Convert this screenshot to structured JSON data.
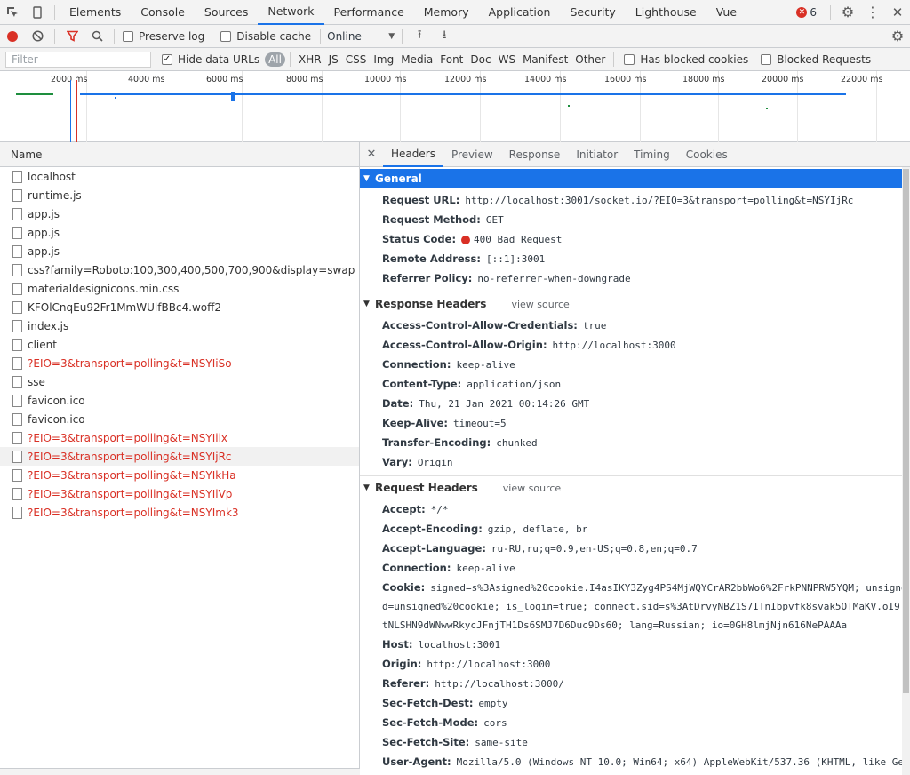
{
  "tabs": [
    "Elements",
    "Console",
    "Sources",
    "Network",
    "Performance",
    "Memory",
    "Application",
    "Security",
    "Lighthouse",
    "Vue"
  ],
  "active_tab": "Network",
  "error_count": "6",
  "toolbar": {
    "preserve_log": "Preserve log",
    "disable_cache": "Disable cache",
    "throttle": "Online"
  },
  "filter": {
    "placeholder": "Filter",
    "hide_data_urls": "Hide data URLs",
    "types": [
      "All",
      "XHR",
      "JS",
      "CSS",
      "Img",
      "Media",
      "Font",
      "Doc",
      "WS",
      "Manifest",
      "Other"
    ],
    "has_blocked_cookies": "Has blocked cookies",
    "blocked_requests": "Blocked Requests"
  },
  "overview": {
    "ticks": [
      "2000 ms",
      "4000 ms",
      "6000 ms",
      "8000 ms",
      "10000 ms",
      "12000 ms",
      "14000 ms",
      "16000 ms",
      "18000 ms",
      "20000 ms",
      "22000 ms"
    ]
  },
  "requests": {
    "header": "Name",
    "items": [
      {
        "name": "localhost",
        "error": false
      },
      {
        "name": "runtime.js",
        "error": false
      },
      {
        "name": "app.js",
        "error": false
      },
      {
        "name": "app.js",
        "error": false
      },
      {
        "name": "app.js",
        "error": false
      },
      {
        "name": "css?family=Roboto:100,300,400,500,700,900&display=swap",
        "error": false
      },
      {
        "name": "materialdesignicons.min.css",
        "error": false
      },
      {
        "name": "KFOlCnqEu92Fr1MmWUlfBBc4.woff2",
        "error": false
      },
      {
        "name": "index.js",
        "error": false
      },
      {
        "name": "client",
        "error": false
      },
      {
        "name": "?EIO=3&transport=polling&t=NSYIiSo",
        "error": true
      },
      {
        "name": "sse",
        "error": false
      },
      {
        "name": "favicon.ico",
        "error": false
      },
      {
        "name": "favicon.ico",
        "error": false
      },
      {
        "name": "?EIO=3&transport=polling&t=NSYIiix",
        "error": true
      },
      {
        "name": "?EIO=3&transport=polling&t=NSYIjRc",
        "error": true
      },
      {
        "name": "?EIO=3&transport=polling&t=NSYIkHa",
        "error": true
      },
      {
        "name": "?EIO=3&transport=polling&t=NSYIlVp",
        "error": true
      },
      {
        "name": "?EIO=3&transport=polling&t=NSYImk3",
        "error": true
      }
    ]
  },
  "details": {
    "tabs": [
      "Headers",
      "Preview",
      "Response",
      "Initiator",
      "Timing",
      "Cookies"
    ],
    "active_tab": "Headers",
    "general": {
      "title": "General",
      "rows": [
        {
          "k": "Request URL:",
          "v": "http://localhost:3001/socket.io/?EIO=3&transport=polling&t=NSYIjRc"
        },
        {
          "k": "Request Method:",
          "v": "GET"
        },
        {
          "k": "Status Code:",
          "v": "400 Bad Request"
        },
        {
          "k": "Remote Address:",
          "v": "[::1]:3001"
        },
        {
          "k": "Referrer Policy:",
          "v": "no-referrer-when-downgrade"
        }
      ]
    },
    "response_headers": {
      "title": "Response Headers",
      "view_source": "view source",
      "rows": [
        {
          "k": "Access-Control-Allow-Credentials:",
          "v": "true"
        },
        {
          "k": "Access-Control-Allow-Origin:",
          "v": "http://localhost:3000"
        },
        {
          "k": "Connection:",
          "v": "keep-alive"
        },
        {
          "k": "Content-Type:",
          "v": "application/json"
        },
        {
          "k": "Date:",
          "v": "Thu, 21 Jan 2021 00:14:26 GMT"
        },
        {
          "k": "Keep-Alive:",
          "v": "timeout=5"
        },
        {
          "k": "Transfer-Encoding:",
          "v": "chunked"
        },
        {
          "k": "Vary:",
          "v": "Origin"
        }
      ]
    },
    "request_headers": {
      "title": "Request Headers",
      "view_source": "view source",
      "rows_before": [
        {
          "k": "Accept:",
          "v": "*/*"
        },
        {
          "k": "Accept-Encoding:",
          "v": "gzip, deflate, br"
        },
        {
          "k": "Accept-Language:",
          "v": "ru-RU,ru;q=0.9,en-US;q=0.8,en;q=0.7"
        },
        {
          "k": "Connection:",
          "v": "keep-alive"
        }
      ],
      "cookie_key": "Cookie:",
      "cookie_lines": [
        "signed=s%3Asigned%20cookie.I4asIKY3Zyg4PS4MjWQYCrAR2bbWo6%2FrkPNNPRW5YQM; unsigne",
        "d=unsigned%20cookie; is_login=true; connect.sid=s%3AtDrvyNBZ1S7ITnIbpvfk8svak5OTMaKV.oI9",
        "tNLSHN9dWNwwRkycJFnjTH1Ds6SMJ7D6Duc9Ds60; lang=Russian; io=0GH8lmjNjn616NePAAAa"
      ],
      "rows_after": [
        {
          "k": "Host:",
          "v": "localhost:3001"
        },
        {
          "k": "Origin:",
          "v": "http://localhost:3000"
        },
        {
          "k": "Referer:",
          "v": "http://localhost:3000/"
        },
        {
          "k": "Sec-Fetch-Dest:",
          "v": "empty"
        },
        {
          "k": "Sec-Fetch-Mode:",
          "v": "cors"
        },
        {
          "k": "Sec-Fetch-Site:",
          "v": "same-site"
        },
        {
          "k": "User-Agent:",
          "v": "Mozilla/5.0 (Windows NT 10.0; Win64; x64) AppleWebKit/537.36 (KHTML, like Gec"
        }
      ]
    }
  }
}
